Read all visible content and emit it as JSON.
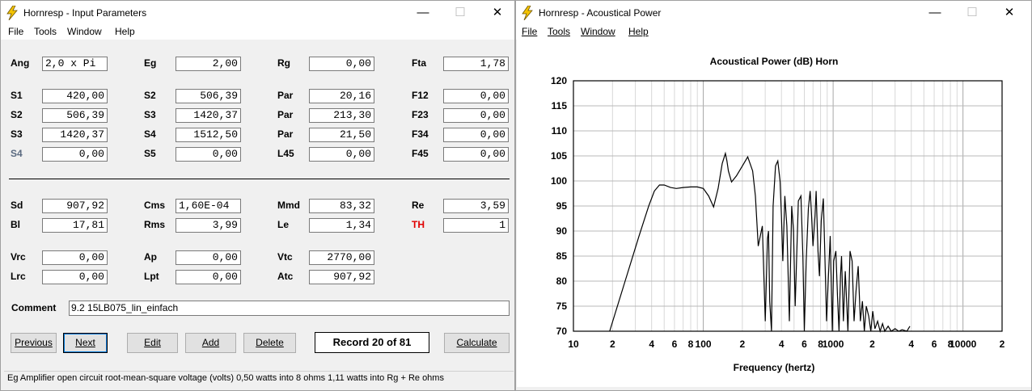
{
  "input_window": {
    "title": "Hornresp - Input Parameters",
    "menu": [
      "File",
      "Tools",
      "Window",
      "Help"
    ],
    "captions": {
      "minimize": "—",
      "maximize": "☐",
      "close": "✕"
    },
    "rows": [
      {
        "cells": [
          {
            "label": "Ang",
            "value": "2,0 x Pi",
            "align": "left"
          },
          {
            "label": "Eg",
            "value": "2,00"
          },
          {
            "label": "Rg",
            "value": "0,00"
          },
          {
            "label": "Fta",
            "value": "1,78"
          }
        ]
      },
      {
        "cells": [
          {
            "label": "S1",
            "value": "420,00"
          },
          {
            "label": "S2",
            "value": "506,39"
          },
          {
            "label": "Par",
            "value": "20,16"
          },
          {
            "label": "F12",
            "value": "0,00"
          }
        ]
      },
      {
        "cells": [
          {
            "label": "S2",
            "value": "506,39"
          },
          {
            "label": "S3",
            "value": "1420,37"
          },
          {
            "label": "Par",
            "value": "213,30"
          },
          {
            "label": "F23",
            "value": "0,00"
          }
        ]
      },
      {
        "cells": [
          {
            "label": "S3",
            "value": "1420,37"
          },
          {
            "label": "S4",
            "value": "1512,50"
          },
          {
            "label": "Par",
            "value": "21,50"
          },
          {
            "label": "F34",
            "value": "0,00"
          }
        ]
      },
      {
        "cells": [
          {
            "label": "S4",
            "value": "0,00",
            "label_color": "#5a6a80"
          },
          {
            "label": "S5",
            "value": "0,00"
          },
          {
            "label": "L45",
            "value": "0,00"
          },
          {
            "label": "F45",
            "value": "0,00"
          }
        ]
      },
      {
        "cells": [
          {
            "label": "Sd",
            "value": "907,92"
          },
          {
            "label": "Cms",
            "value": "1,60E-04",
            "align": "left"
          },
          {
            "label": "Mmd",
            "value": "83,32"
          },
          {
            "label": "Re",
            "value": "3,59"
          }
        ]
      },
      {
        "cells": [
          {
            "label": "Bl",
            "value": "17,81"
          },
          {
            "label": "Rms",
            "value": "3,99"
          },
          {
            "label": "Le",
            "value": "1,34"
          },
          {
            "label": "TH",
            "value": "1",
            "label_color": "#e00000"
          }
        ]
      },
      {
        "cells": [
          {
            "label": "Vrc",
            "value": "0,00"
          },
          {
            "label": "Ap",
            "value": "0,00"
          },
          {
            "label": "Vtc",
            "value": "2770,00"
          }
        ]
      },
      {
        "cells": [
          {
            "label": "Lrc",
            "value": "0,00"
          },
          {
            "label": "Lpt",
            "value": "0,00"
          },
          {
            "label": "Atc",
            "value": "907,92"
          }
        ]
      }
    ],
    "comment_label": "Comment",
    "comment_value": "9.2 15LB075_lin_einfach",
    "buttons": {
      "previous": "Previous",
      "next": "Next",
      "edit": "Edit",
      "add": "Add",
      "delete": "Delete",
      "calculate": "Calculate"
    },
    "record": "Record 20 of 81",
    "status": "Eg  Amplifier open circuit root-mean-square voltage  (volts)  0,50 watts into 8 ohms   1,11 watts into Rg + Re ohms"
  },
  "power_window": {
    "title": "Hornresp - Acoustical Power",
    "menu": [
      "File",
      "Tools",
      "Window",
      "Help"
    ],
    "captions": {
      "minimize": "—",
      "maximize": "☐",
      "close": "✕"
    }
  },
  "chart_data": {
    "type": "line",
    "title": "Acoustical Power (dB)   Horn",
    "xlabel": "Frequency (hertz)",
    "ylabel": "",
    "xscale": "log",
    "xlim": [
      10,
      20000
    ],
    "ylim": [
      70,
      120
    ],
    "yticks": [
      70,
      75,
      80,
      85,
      90,
      95,
      100,
      105,
      110,
      115,
      120
    ],
    "xtick_labels": [
      {
        "x": 10,
        "label": "10"
      },
      {
        "x": 20,
        "label": "2"
      },
      {
        "x": 40,
        "label": "4"
      },
      {
        "x": 60,
        "label": "6"
      },
      {
        "x": 80,
        "label": "8"
      },
      {
        "x": 100,
        "label": "100"
      },
      {
        "x": 200,
        "label": "2"
      },
      {
        "x": 400,
        "label": "4"
      },
      {
        "x": 600,
        "label": "6"
      },
      {
        "x": 800,
        "label": "8"
      },
      {
        "x": 1000,
        "label": "1000"
      },
      {
        "x": 2000,
        "label": "2"
      },
      {
        "x": 4000,
        "label": "4"
      },
      {
        "x": 6000,
        "label": "6"
      },
      {
        "x": 8000,
        "label": "8"
      },
      {
        "x": 10000,
        "label": "10000"
      },
      {
        "x": 20000,
        "label": "2"
      }
    ],
    "grid": true,
    "line_color": "#000000",
    "series": [
      {
        "x": [
          19,
          25,
          32,
          38,
          42,
          46,
          50,
          56,
          62,
          70,
          80,
          90,
          100,
          110,
          120,
          130,
          140,
          148,
          152,
          156,
          165,
          180,
          200,
          220,
          240,
          252,
          265,
          285,
          300,
          312,
          318,
          325,
          335,
          345,
          360,
          375,
          390,
          400,
          410,
          425,
          440,
          460,
          480,
          495,
          510,
          540,
          565,
          585,
          600,
          620,
          645,
          665,
          680,
          700,
          725,
          740,
          765,
          785,
          810,
          840,
          860,
          890,
          920,
          950,
          985,
          1010,
          1050,
          1080,
          1110,
          1140,
          1160,
          1200,
          1240,
          1270,
          1300,
          1350,
          1400,
          1450,
          1500,
          1560,
          1620,
          1680,
          1740,
          1800,
          1880,
          1950,
          2020,
          2100,
          2200,
          2300,
          2400,
          2500,
          2650,
          2800,
          3000,
          3200,
          3400,
          3700,
          3900
        ],
        "y": [
          70,
          80,
          89,
          95,
          98,
          99.2,
          99.2,
          98.7,
          98.5,
          98.7,
          98.8,
          98.8,
          98.5,
          97.0,
          94.8,
          98.5,
          103.5,
          105.5,
          104.0,
          102.0,
          99.8,
          101.0,
          103.0,
          104.8,
          102.0,
          97.0,
          87.0,
          91.0,
          72.0,
          88.5,
          90.0,
          76.0,
          70.0,
          95.0,
          103.0,
          104.0,
          100.0,
          93.0,
          84.0,
          97.0,
          91.0,
          72.0,
          95.0,
          90.0,
          75.0,
          96.0,
          97.0,
          85.0,
          70.0,
          84.0,
          94.5,
          98.0,
          94.0,
          87.0,
          93.0,
          98.0,
          86.0,
          81.0,
          92.0,
          96.5,
          87.0,
          72.0,
          81.0,
          89.0,
          70.0,
          84.0,
          86.0,
          77.0,
          70.0,
          81.0,
          85.0,
          72.0,
          82.0,
          76.0,
          70.0,
          86.0,
          84.0,
          72.0,
          78.0,
          83.0,
          72.0,
          76.0,
          70.0,
          75.0,
          73.0,
          70.0,
          74.0,
          70.5,
          72.0,
          70.0,
          71.5,
          70.0,
          71.0,
          70.0,
          70.5,
          70.0,
          70.3,
          70.0,
          71.0
        ]
      }
    ]
  }
}
